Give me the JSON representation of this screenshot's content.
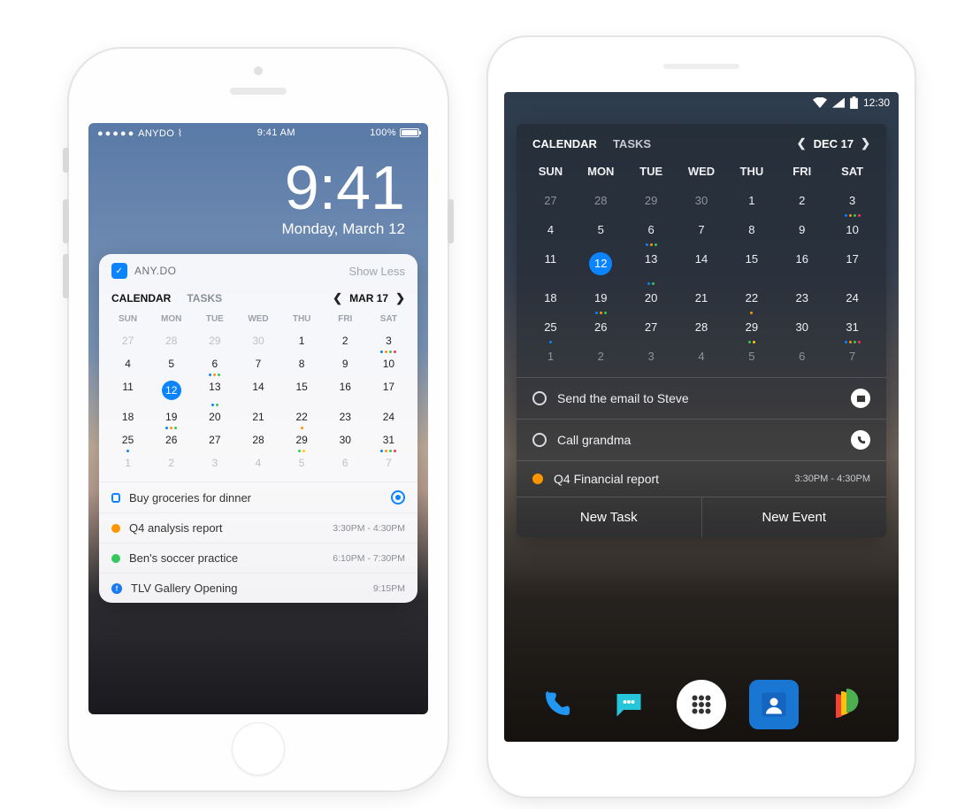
{
  "ios": {
    "carrier": "ANYDO",
    "status_time": "9:41 AM",
    "battery": "100%",
    "big_time": "9:41",
    "big_date": "Monday, March 12",
    "widget_app_name": "ANY.DO",
    "show_less": "Show Less",
    "tabs": {
      "calendar": "CALENDAR",
      "tasks": "TASKS"
    },
    "month_label": "MAR 17",
    "weekdays": [
      "SUN",
      "MON",
      "TUE",
      "WED",
      "THU",
      "FRI",
      "SAT"
    ],
    "weeks": [
      [
        {
          "n": "27",
          "muted": true
        },
        {
          "n": "28",
          "muted": true
        },
        {
          "n": "29",
          "muted": true
        },
        {
          "n": "30",
          "muted": true
        },
        {
          "n": "1"
        },
        {
          "n": "2"
        },
        {
          "n": "3",
          "marks": [
            "bl",
            "or",
            "gr",
            "pk"
          ]
        }
      ],
      [
        {
          "n": "4"
        },
        {
          "n": "5"
        },
        {
          "n": "6",
          "marks": [
            "bl",
            "or",
            "gr"
          ]
        },
        {
          "n": "7"
        },
        {
          "n": "8"
        },
        {
          "n": "9"
        },
        {
          "n": "10"
        }
      ],
      [
        {
          "n": "11"
        },
        {
          "n": "12",
          "selected": true
        },
        {
          "n": "13",
          "marks": [
            "bl",
            "gr"
          ]
        },
        {
          "n": "14"
        },
        {
          "n": "15"
        },
        {
          "n": "16"
        },
        {
          "n": "17"
        }
      ],
      [
        {
          "n": "18"
        },
        {
          "n": "19",
          "marks": [
            "bl",
            "or",
            "gr"
          ]
        },
        {
          "n": "20"
        },
        {
          "n": "21"
        },
        {
          "n": "22",
          "marks": [
            "or"
          ]
        },
        {
          "n": "23"
        },
        {
          "n": "24"
        }
      ],
      [
        {
          "n": "25",
          "marks": [
            "bl"
          ]
        },
        {
          "n": "26"
        },
        {
          "n": "27"
        },
        {
          "n": "28"
        },
        {
          "n": "29",
          "marks": [
            "gr",
            "ye"
          ]
        },
        {
          "n": "30"
        },
        {
          "n": "31",
          "marks": [
            "bl",
            "or",
            "gr",
            "pk"
          ]
        }
      ],
      [
        {
          "n": "1",
          "muted": true
        },
        {
          "n": "2",
          "muted": true
        },
        {
          "n": "3",
          "muted": true
        },
        {
          "n": "4",
          "muted": true
        },
        {
          "n": "5",
          "muted": true
        },
        {
          "n": "6",
          "muted": true
        },
        {
          "n": "7",
          "muted": true
        }
      ]
    ],
    "events": [
      {
        "kind": "task",
        "title": "Buy groceries for dinner",
        "target": true
      },
      {
        "kind": "event",
        "color": "#ff9500",
        "title": "Q4 analysis report",
        "time": "3:30PM - 4:30PM"
      },
      {
        "kind": "event",
        "color": "#34c759",
        "title": "Ben's soccer practice",
        "time": "6:10PM - 7:30PM"
      },
      {
        "kind": "fb",
        "title": "TLV Gallery Opening",
        "time": "9:15PM"
      }
    ]
  },
  "android": {
    "status_time": "12:30",
    "tabs": {
      "calendar": "CALENDAR",
      "tasks": "TASKS"
    },
    "month_label": "DEC 17",
    "weekdays": [
      "SUN",
      "MON",
      "TUE",
      "WED",
      "THU",
      "FRI",
      "SAT"
    ],
    "weeks": [
      [
        {
          "n": "27",
          "muted": true
        },
        {
          "n": "28",
          "muted": true
        },
        {
          "n": "29",
          "muted": true
        },
        {
          "n": "30",
          "muted": true
        },
        {
          "n": "1"
        },
        {
          "n": "2"
        },
        {
          "n": "3",
          "marks": [
            "bl",
            "or",
            "gr",
            "pk"
          ]
        }
      ],
      [
        {
          "n": "4"
        },
        {
          "n": "5"
        },
        {
          "n": "6",
          "marks": [
            "bl",
            "or",
            "gr"
          ]
        },
        {
          "n": "7"
        },
        {
          "n": "8"
        },
        {
          "n": "9"
        },
        {
          "n": "10"
        }
      ],
      [
        {
          "n": "11"
        },
        {
          "n": "12",
          "selected": true
        },
        {
          "n": "13",
          "marks": [
            "bl",
            "gr"
          ]
        },
        {
          "n": "14"
        },
        {
          "n": "15"
        },
        {
          "n": "16"
        },
        {
          "n": "17"
        }
      ],
      [
        {
          "n": "18"
        },
        {
          "n": "19",
          "marks": [
            "bl",
            "or",
            "gr"
          ]
        },
        {
          "n": "20"
        },
        {
          "n": "21"
        },
        {
          "n": "22",
          "marks": [
            "or"
          ]
        },
        {
          "n": "23"
        },
        {
          "n": "24"
        }
      ],
      [
        {
          "n": "25",
          "marks": [
            "bl"
          ]
        },
        {
          "n": "26"
        },
        {
          "n": "27"
        },
        {
          "n": "28"
        },
        {
          "n": "29",
          "marks": [
            "gr",
            "ye"
          ]
        },
        {
          "n": "30"
        },
        {
          "n": "31",
          "marks": [
            "bl",
            "or",
            "gr",
            "pk"
          ]
        }
      ],
      [
        {
          "n": "1",
          "muted": true
        },
        {
          "n": "2",
          "muted": true
        },
        {
          "n": "3",
          "muted": true
        },
        {
          "n": "4",
          "muted": true
        },
        {
          "n": "5",
          "muted": true
        },
        {
          "n": "6",
          "muted": true
        },
        {
          "n": "7",
          "muted": true
        }
      ]
    ],
    "events": [
      {
        "kind": "task-circle",
        "title": "Send the email to Steve",
        "icon": "mail"
      },
      {
        "kind": "task-circle",
        "title": "Call grandma",
        "icon": "phone"
      },
      {
        "kind": "dot-or",
        "title": "Q4 Financial report",
        "time": "3:30PM - 4:30PM"
      }
    ],
    "actions": {
      "new_task": "New Task",
      "new_event": "New Event"
    }
  }
}
